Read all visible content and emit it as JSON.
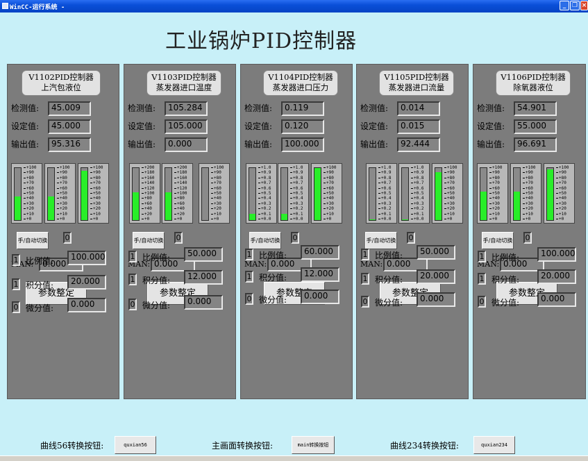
{
  "window": {
    "title": "WinCC-运行系统 -"
  },
  "main_title": "工业锅炉PID控制器",
  "labels": {
    "measured": "检测值:",
    "setpoint": "设定值:",
    "output": "输出值:",
    "man": "MAN:",
    "param_button": "参数整定",
    "mode_button": "手/自动切换",
    "kp": "比例值:",
    "ki": "积分值:",
    "kd": "微分值:"
  },
  "panels": [
    {
      "name_line1": "V1102PID控制器",
      "name_line2": "上汽包液位",
      "measured": "45.009",
      "setpoint": "45.000",
      "output": "95.316",
      "mode_value": "0",
      "man_value": "0.000",
      "kp_flag": "1",
      "ki_flag": "1",
      "kd_flag": "0",
      "kp": "100.000",
      "ki": "20.000",
      "kd": "0.000",
      "gauges": [
        {
          "scale": [
            "+100",
            "+90",
            "+80",
            "+70",
            "+60",
            "+50",
            "+40",
            "+30",
            "+20",
            "+10",
            "+0"
          ],
          "fill": 0.45
        },
        {
          "scale": [
            "+100",
            "+90",
            "+80",
            "+70",
            "+60",
            "+50",
            "+40",
            "+30",
            "+20",
            "+10",
            "+0"
          ],
          "fill": 0.45
        },
        {
          "scale": [
            "+100",
            "+90",
            "+80",
            "+70",
            "+60",
            "+50",
            "+40",
            "+30",
            "+20",
            "+10",
            "+0"
          ],
          "fill": 0.95
        }
      ]
    },
    {
      "name_line1": "V1103PID控制器",
      "name_line2": "蒸发器进口温度",
      "measured": "105.284",
      "setpoint": "105.000",
      "output": "0.000",
      "mode_value": "0",
      "man_value": "0.000",
      "kp_flag": "1",
      "ki_flag": "1",
      "kd_flag": "0",
      "kp": "50.000",
      "ki": "12.000",
      "kd": "0.000",
      "gauges": [
        {
          "scale": [
            "+200",
            "+180",
            "+160",
            "+140",
            "+120",
            "+100",
            "+80",
            "+60",
            "+40",
            "+20",
            "+0"
          ],
          "fill": 0.53
        },
        {
          "scale": [
            "+200",
            "+180",
            "+160",
            "+140",
            "+120",
            "+100",
            "+80",
            "+60",
            "+40",
            "+20",
            "+0"
          ],
          "fill": 0.53
        },
        {
          "scale": [
            "+100",
            "+90",
            "+80",
            "+70",
            "+60",
            "+50",
            "+40",
            "+30",
            "+20",
            "+10",
            "+0"
          ],
          "fill": 0
        }
      ]
    },
    {
      "name_line1": "V1104PID控制器",
      "name_line2": "蒸发器进口压力",
      "measured": "0.119",
      "setpoint": "0.120",
      "output": "100.000",
      "mode_value": "0",
      "man_value": "0.000",
      "kp_flag": "1",
      "ki_flag": "1",
      "kd_flag": "0",
      "kp": "60.000",
      "ki": "12.000",
      "kd": "0.000",
      "gauges": [
        {
          "scale": [
            "+1.0",
            "+0.9",
            "+0.8",
            "+0.7",
            "+0.6",
            "+0.5",
            "+0.4",
            "+0.3",
            "+0.2",
            "+0.1",
            "+0.0"
          ],
          "fill": 0.119
        },
        {
          "scale": [
            "+1.0",
            "+0.9",
            "+0.8",
            "+0.7",
            "+0.6",
            "+0.5",
            "+0.4",
            "+0.3",
            "+0.2",
            "+0.1",
            "+0.0"
          ],
          "fill": 0.12
        },
        {
          "scale": [
            "+100",
            "+90",
            "+80",
            "+70",
            "+60",
            "+50",
            "+40",
            "+30",
            "+20",
            "+10",
            "+0"
          ],
          "fill": 1.0
        }
      ]
    },
    {
      "name_line1": "V1105PID控制器",
      "name_line2": "蒸发器进口流量",
      "measured": "0.014",
      "setpoint": "0.015",
      "output": "92.444",
      "mode_value": "0",
      "man_value": "0.000",
      "kp_flag": "1",
      "ki_flag": "1",
      "kd_flag": "0",
      "kp": "50.000",
      "ki": "20.000",
      "kd": "0.000",
      "gauges": [
        {
          "scale": [
            "+1.0",
            "+0.9",
            "+0.8",
            "+0.7",
            "+0.6",
            "+0.5",
            "+0.4",
            "+0.3",
            "+0.2",
            "+0.1",
            "+0.0"
          ],
          "fill": 0.014
        },
        {
          "scale": [
            "+1.0",
            "+0.9",
            "+0.8",
            "+0.7",
            "+0.6",
            "+0.5",
            "+0.4",
            "+0.3",
            "+0.2",
            "+0.1",
            "+0.0"
          ],
          "fill": 0.015
        },
        {
          "scale": [
            "+100",
            "+90",
            "+80",
            "+70",
            "+60",
            "+50",
            "+40",
            "+30",
            "+20",
            "+10",
            "+0"
          ],
          "fill": 0.92
        }
      ]
    },
    {
      "name_line1": "V1106PID控制器",
      "name_line2": "除氧器液位",
      "measured": "54.901",
      "setpoint": "55.000",
      "output": "96.691",
      "mode_value": "0",
      "man_value": "0.000",
      "kp_flag": "1",
      "ki_flag": "1",
      "kd_flag": "0",
      "kp": "100.000",
      "ki": "20.000",
      "kd": "0.000",
      "gauges": [
        {
          "scale": [
            "+100",
            "+90",
            "+80",
            "+70",
            "+60",
            "+50",
            "+40",
            "+30",
            "+20",
            "+10",
            "+0"
          ],
          "fill": 0.55
        },
        {
          "scale": [
            "+100",
            "+90",
            "+80",
            "+70",
            "+60",
            "+50",
            "+40",
            "+30",
            "+20",
            "+10",
            "+0"
          ],
          "fill": 0.55
        },
        {
          "scale": [
            "+100",
            "+90",
            "+80",
            "+70",
            "+60",
            "+50",
            "+40",
            "+30",
            "+20",
            "+10",
            "+0"
          ],
          "fill": 0.97
        }
      ]
    }
  ],
  "nav": {
    "curve56_label": "曲线56转换按钮:",
    "curve56_button": "quxian56",
    "main_label": "主画面转换按钮:",
    "main_button": "main转换按钮",
    "curve234_label": "曲线234转换按钮:",
    "curve234_button": "quxian234"
  },
  "colors": {
    "bar_fill": "#29ee29",
    "panel_bg": "#7c7c7c",
    "page_bg": "#c8f0f8"
  }
}
